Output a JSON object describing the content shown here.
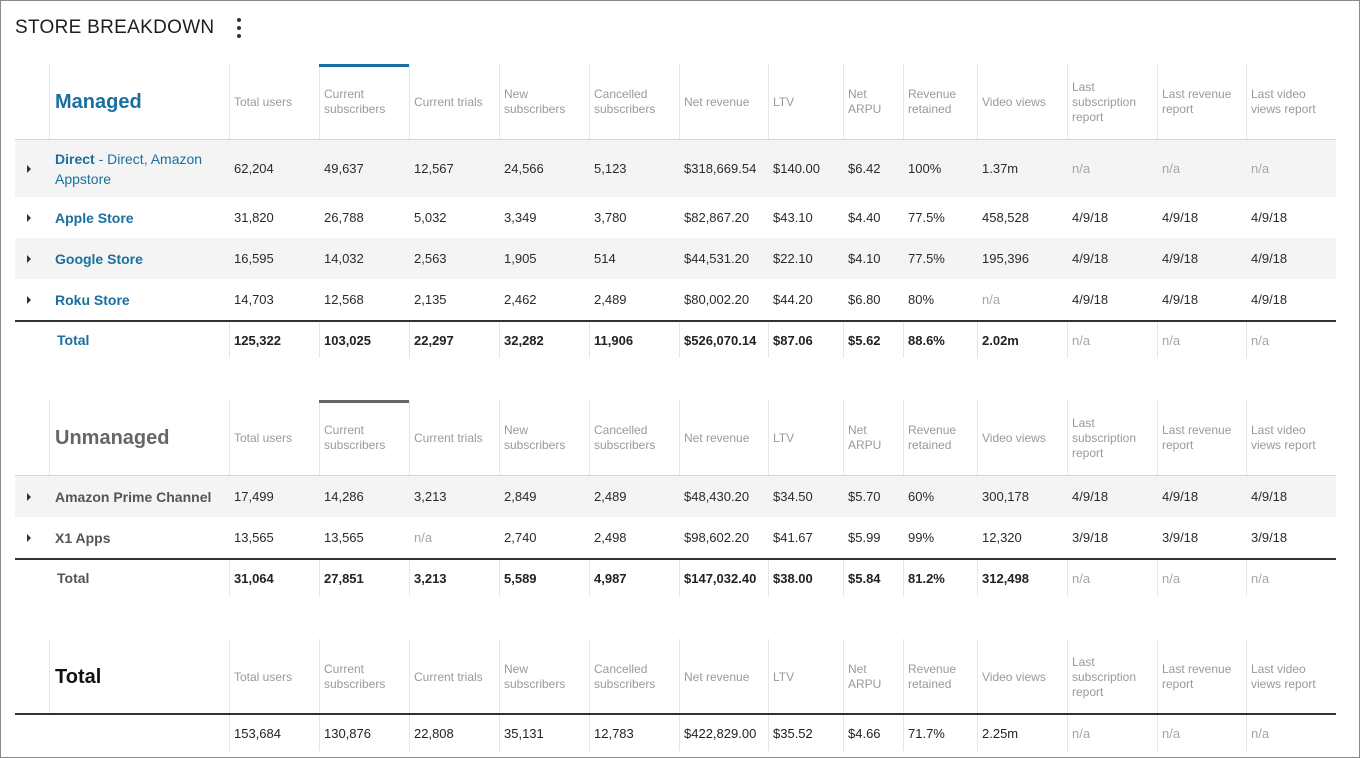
{
  "header": {
    "title": "STORE BREAKDOWN"
  },
  "columns": [
    [
      "Total users"
    ],
    [
      "Current",
      "subscribers"
    ],
    [
      "Current trials"
    ],
    [
      "New",
      "subscribers"
    ],
    [
      "Cancelled",
      "subscribers"
    ],
    [
      "Net revenue"
    ],
    [
      "LTV"
    ],
    [
      "Net",
      "ARPU"
    ],
    [
      "Revenue",
      "retained"
    ],
    [
      "Video views"
    ],
    [
      "Last",
      "subscription",
      "report"
    ],
    [
      "Last revenue",
      "report"
    ],
    [
      "Last video",
      "views report"
    ]
  ],
  "colors": {
    "managed_accent": "#1a6f9e",
    "unmanaged_accent": "#666666",
    "link": "#1a6f9e",
    "na": "#a6a6a6"
  },
  "managed": {
    "title": "Managed",
    "rows": [
      {
        "name": "Direct",
        "sub": " - Direct, Amazon Appstore",
        "values": [
          "62,204",
          "49,637",
          "12,567",
          "24,566",
          "5,123",
          "$318,669.54",
          "$140.00",
          "$6.42",
          "100%",
          "1.37m",
          "n/a",
          "n/a",
          "n/a"
        ]
      },
      {
        "name": "Apple Store",
        "values": [
          "31,820",
          "26,788",
          "5,032",
          "3,349",
          "3,780",
          "$82,867.20",
          "$43.10",
          "$4.40",
          "77.5%",
          "458,528",
          "4/9/18",
          "4/9/18",
          "4/9/18"
        ]
      },
      {
        "name": "Google Store",
        "values": [
          "16,595",
          "14,032",
          "2,563",
          "1,905",
          "514",
          "$44,531.20",
          "$22.10",
          "$4.10",
          "77.5%",
          "195,396",
          "4/9/18",
          "4/9/18",
          "4/9/18"
        ]
      },
      {
        "name": "Roku Store",
        "values": [
          "14,703",
          "12,568",
          "2,135",
          "2,462",
          "2,489",
          "$80,002.20",
          "$44.20",
          "$6.80",
          "80%",
          "n/a",
          "4/9/18",
          "4/9/18",
          "4/9/18"
        ]
      }
    ],
    "total": {
      "label": "Total",
      "values": [
        "125,322",
        "103,025",
        "22,297",
        "32,282",
        "11,906",
        "$526,070.14",
        "$87.06",
        "$5.62",
        "88.6%",
        "2.02m",
        "n/a",
        "n/a",
        "n/a"
      ]
    }
  },
  "unmanaged": {
    "title": "Unmanaged",
    "rows": [
      {
        "name": "Amazon Prime Channel",
        "values": [
          "17,499",
          "14,286",
          "3,213",
          "2,849",
          "2,489",
          "$48,430.20",
          "$34.50",
          "$5.70",
          "60%",
          "300,178",
          "4/9/18",
          "4/9/18",
          "4/9/18"
        ]
      },
      {
        "name": "X1 Apps",
        "values": [
          "13,565",
          "13,565",
          "n/a",
          "2,740",
          "2,498",
          "$98,602.20",
          "$41.67",
          "$5.99",
          "99%",
          "12,320",
          "3/9/18",
          "3/9/18",
          "3/9/18"
        ]
      }
    ],
    "total": {
      "label": "Total",
      "values": [
        "31,064",
        "27,851",
        "3,213",
        "5,589",
        "4,987",
        "$147,032.40",
        "$38.00",
        "$5.84",
        "81.2%",
        "312,498",
        "n/a",
        "n/a",
        "n/a"
      ]
    }
  },
  "grand": {
    "title": "Total",
    "values": [
      "153,684",
      "130,876",
      "22,808",
      "35,131",
      "12,783",
      "$422,829.00",
      "$35.52",
      "$4.66",
      "71.7%",
      "2.25m",
      "n/a",
      "n/a",
      "n/a"
    ]
  }
}
